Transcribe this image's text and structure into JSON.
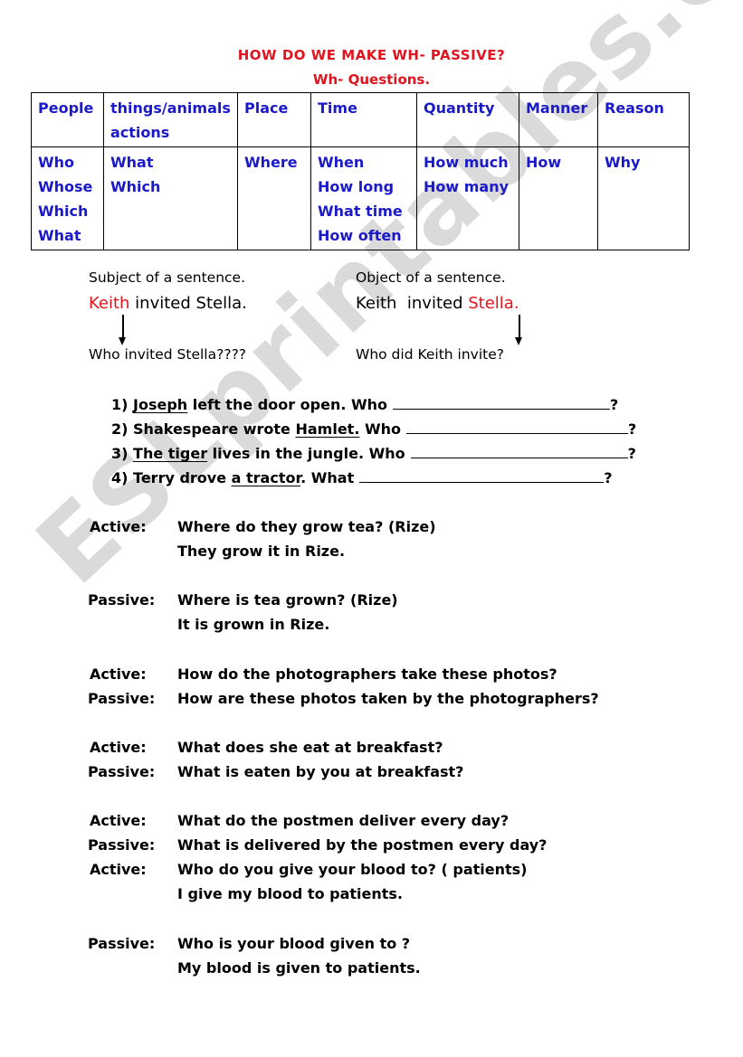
{
  "header": {
    "title": "HOW DO WE MAKE WH- PASSIVE?",
    "subtitle": "Wh- Questions."
  },
  "wh_table": {
    "headers": [
      [
        "People"
      ],
      [
        "things/animals",
        "actions"
      ],
      [
        "Place"
      ],
      [
        "Time"
      ],
      [
        "Quantity"
      ],
      [
        "Manner"
      ],
      [
        "Reason"
      ]
    ],
    "cells": [
      [
        "Who",
        "Whose",
        "Which",
        "What"
      ],
      [
        "What",
        "Which"
      ],
      [
        "Where"
      ],
      [
        "When",
        "How long",
        "What time",
        "How often"
      ],
      [
        "How much",
        "How many"
      ],
      [
        "How"
      ],
      [
        "Why"
      ]
    ]
  },
  "subject_object": {
    "subject_heading": "Subject of a sentence.",
    "subject_highlight": "Keith",
    "subject_rest": " invited Stella.",
    "subject_question": "Who invited Stella????",
    "object_heading": "Object of a sentence.",
    "object_rest": "Keith  invited ",
    "object_highlight": "Stella.",
    "object_question": "Who did Keith invite?"
  },
  "exercises": [
    {
      "num": "1)",
      "pre": "",
      "underlined": "Joseph",
      "post": " left the door open. Who",
      "end": "?"
    },
    {
      "num": "2)",
      "pre": "Shakespeare wrote ",
      "underlined": "Hamlet.",
      "post": " Who",
      "end": "?"
    },
    {
      "num": "3)",
      "pre": "",
      "underlined": "The tiger",
      "post": " lives in the jungle. Who",
      "end": "?"
    },
    {
      "num": "4)",
      "pre": "Terry drove ",
      "underlined": "a tractor",
      "post": ". What",
      "end": "?"
    }
  ],
  "examples": [
    {
      "label": "Active:",
      "text": "Where do they grow tea? (Rize)"
    },
    {
      "label": "",
      "text": "They grow it in Rize."
    },
    {
      "label": "Passive:",
      "text": "Where is tea grown? (Rize)"
    },
    {
      "label": "",
      "text": "It is grown in Rize."
    },
    {
      "label": "Active:",
      "text": "How do the photographers take these photos?"
    },
    {
      "label": "Passive:",
      "text": "How are these photos taken by the photographers?"
    },
    {
      "label": "Active:",
      "text": "What does she eat at breakfast?"
    },
    {
      "label": "Passive:",
      "text": "What is eaten by you at breakfast?"
    },
    {
      "label": "Active:",
      "text": "What do the postmen deliver every day?"
    },
    {
      "label": "Passive:",
      "text": "What is delivered by the postmen every day?"
    },
    {
      "label": "Active:",
      "text": "Who do you give your blood to? ( patients)"
    },
    {
      "label": "",
      "text": "I give my blood to patients."
    },
    {
      "label": "Passive:",
      "text": "Who is your blood given to ?"
    },
    {
      "label": "",
      "text": "My blood is given to patients."
    }
  ],
  "watermark": "ESLprintables.com",
  "colors": {
    "title_red": "#e0141e",
    "table_blue": "#1a1ac8"
  }
}
